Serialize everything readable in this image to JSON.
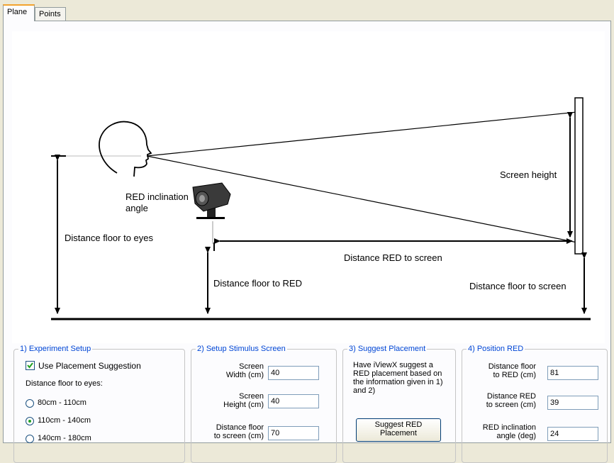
{
  "tabs": [
    {
      "label": "Plane",
      "active": true
    },
    {
      "label": "Points",
      "active": false
    }
  ],
  "diagram": {
    "red_inclination_line1": "RED inclination",
    "red_inclination_line2": "angle",
    "distance_floor_to_eyes": "Distance floor to eyes",
    "distance_floor_to_red": "Distance floor to RED",
    "distance_red_to_screen": "Distance RED to screen",
    "screen_height": "Screen height",
    "distance_floor_to_screen": "Distance floor to screen"
  },
  "experiment_setup": {
    "title": "1) Experiment Setup",
    "use_placement_label": "Use Placement Suggestion",
    "use_placement_checked": true,
    "distance_label": "Distance floor to eyes:",
    "options": [
      {
        "label": "80cm - 110cm",
        "selected": false
      },
      {
        "label": "110cm - 140cm",
        "selected": true
      },
      {
        "label": "140cm - 180cm",
        "selected": false
      }
    ]
  },
  "stimulus_screen": {
    "title": "2) Setup Stimulus Screen",
    "width_label": "Screen\nWidth (cm)",
    "width_value": "40",
    "height_label": "Screen\nHeight (cm)",
    "height_value": "40",
    "floor_label": "Distance floor\nto screen (cm)",
    "floor_value": "70"
  },
  "suggest_placement": {
    "title": "3) Suggest Placement",
    "description": "Have iViewX suggest a RED placement based on the information given in 1) and 2)",
    "button_label": "Suggest RED\nPlacement"
  },
  "position_red": {
    "title": "4) Position RED",
    "floor_label": "Distance floor\nto RED (cm)",
    "floor_value": "81",
    "screen_label": "Distance RED\nto screen (cm)",
    "screen_value": "39",
    "angle_label": "RED inclination\nangle (deg)",
    "angle_value": "24"
  },
  "colors": {
    "accent_tab": "#f3a32d",
    "group_title": "#0046d5",
    "radio_selected": "#21a121"
  }
}
